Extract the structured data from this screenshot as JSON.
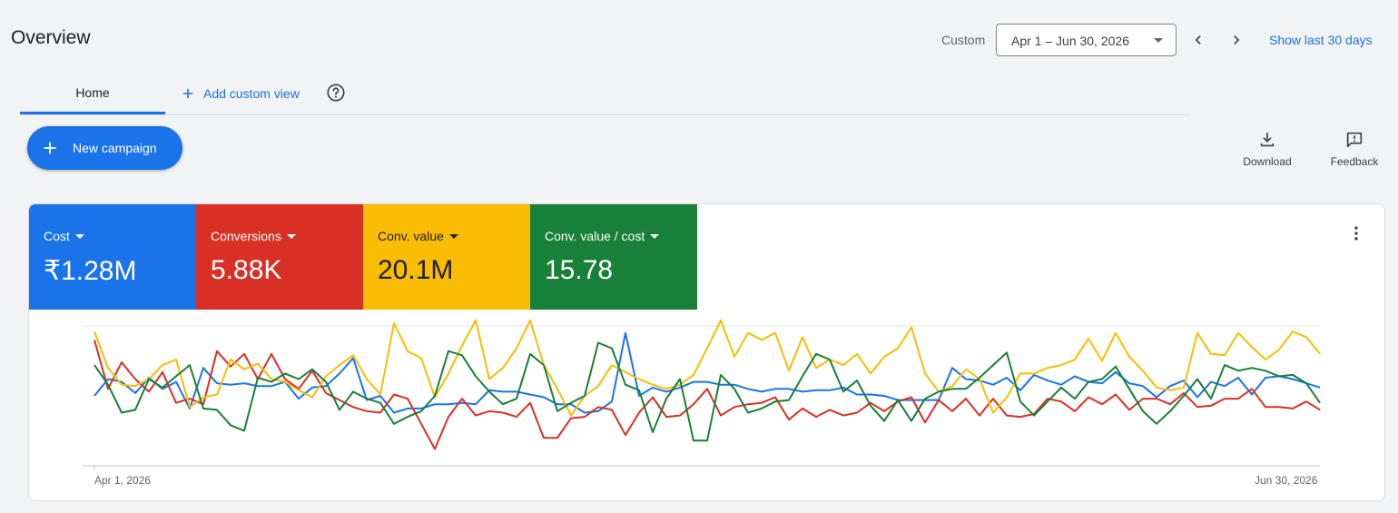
{
  "page": {
    "title": "Overview"
  },
  "date_range": {
    "label": "Custom",
    "value": "Apr 1 – Jun 30, 2026",
    "show_last_label": "Show last 30 days"
  },
  "tabs": {
    "home": "Home",
    "add_custom_view": "Add custom view"
  },
  "actions": {
    "new_campaign": "New campaign",
    "download": "Download",
    "feedback": "Feedback"
  },
  "metrics": [
    {
      "name": "Cost",
      "value": "₹1.28M",
      "color": "#1a73e8"
    },
    {
      "name": "Conversions",
      "value": "5.88K",
      "color": "#d93025"
    },
    {
      "name": "Conv. value",
      "value": "20.1M",
      "color": "#fbbc04"
    },
    {
      "name": "Conv. value / cost",
      "value": "15.78",
      "color": "#188038"
    }
  ],
  "icons": [
    "chevron-left-icon",
    "chevron-right-icon",
    "plus-icon",
    "help-icon",
    "download-icon",
    "feedback-icon",
    "more-vert-icon"
  ],
  "chart_data": {
    "type": "line",
    "x_start_label": "Apr 1, 2026",
    "x_end_label": "Jun 30, 2026",
    "x": [
      "Apr 1",
      "Apr 2",
      "Apr 3",
      "Apr 4",
      "Apr 5",
      "Apr 6",
      "Apr 7",
      "Apr 8",
      "Apr 9",
      "Apr 10",
      "Apr 11",
      "Apr 12",
      "Apr 13",
      "Apr 14",
      "Apr 15",
      "Apr 16",
      "Apr 17",
      "Apr 18",
      "Apr 19",
      "Apr 20",
      "Apr 21",
      "Apr 22",
      "Apr 23",
      "Apr 24",
      "Apr 25",
      "Apr 26",
      "Apr 27",
      "Apr 28",
      "Apr 29",
      "Apr 30",
      "May 1",
      "May 2",
      "May 3",
      "May 4",
      "May 5",
      "May 6",
      "May 7",
      "May 8",
      "May 9",
      "May 10",
      "May 11",
      "May 12",
      "May 13",
      "May 14",
      "May 15",
      "May 16",
      "May 17",
      "May 18",
      "May 19",
      "May 20",
      "May 21",
      "May 22",
      "May 23",
      "May 24",
      "May 25",
      "May 26",
      "May 27",
      "May 28",
      "May 29",
      "May 30",
      "May 31",
      "Jun 1",
      "Jun 2",
      "Jun 3",
      "Jun 4",
      "Jun 5",
      "Jun 6",
      "Jun 7",
      "Jun 8",
      "Jun 9",
      "Jun 10",
      "Jun 11",
      "Jun 12",
      "Jun 13",
      "Jun 14",
      "Jun 15",
      "Jun 16",
      "Jun 17",
      "Jun 18",
      "Jun 19",
      "Jun 20",
      "Jun 21",
      "Jun 22",
      "Jun 23",
      "Jun 24",
      "Jun 25",
      "Jun 26",
      "Jun 27",
      "Jun 28",
      "Jun 29",
      "Jun 30"
    ],
    "ylim": [
      0,
      100
    ],
    "grid": true,
    "series": [
      {
        "name": "Cost",
        "color": "#1a73e8",
        "values": [
          50,
          62,
          60,
          52,
          63,
          55,
          60,
          41,
          70,
          59,
          58,
          59,
          57,
          57,
          60,
          48,
          56,
          57,
          66,
          77,
          47,
          50,
          38,
          41,
          41,
          44,
          44,
          45,
          44,
          54,
          53,
          53,
          51,
          49,
          44,
          44,
          38,
          39,
          46,
          95,
          50,
          56,
          53,
          56,
          60,
          60,
          58,
          58,
          55,
          53,
          55,
          55,
          53,
          54,
          54,
          56,
          51,
          51,
          50,
          47,
          47,
          47,
          47,
          70,
          62,
          61,
          58,
          63,
          54,
          65,
          61,
          58,
          64,
          60,
          59,
          67,
          59,
          57,
          49,
          57,
          61,
          49,
          60,
          57,
          63,
          51,
          63,
          64,
          62,
          59,
          56
        ]
      },
      {
        "name": "Conversions",
        "color": "#d93025",
        "values": [
          90,
          55,
          74,
          62,
          53,
          67,
          45,
          48,
          44,
          82,
          71,
          80,
          62,
          80,
          62,
          55,
          68,
          52,
          47,
          42,
          39,
          38,
          51,
          48,
          30,
          12,
          35,
          48,
          36,
          39,
          38,
          35,
          45,
          20,
          20,
          34,
          35,
          42,
          40,
          22,
          38,
          49,
          35,
          36,
          44,
          55,
          36,
          42,
          44,
          45,
          49,
          33,
          41,
          35,
          40,
          36,
          38,
          45,
          39,
          46,
          49,
          31,
          47,
          39,
          48,
          36,
          48,
          36,
          35,
          37,
          48,
          46,
          39,
          49,
          44,
          51,
          40,
          48,
          48,
          44,
          52,
          42,
          43,
          48,
          48,
          55,
          42,
          42,
          41,
          46,
          40
        ]
      },
      {
        "name": "Conv. value",
        "color": "#fbbc04",
        "values": [
          96,
          70,
          58,
          57,
          62,
          72,
          76,
          42,
          49,
          51,
          76,
          69,
          73,
          62,
          60,
          54,
          49,
          64,
          72,
          79,
          62,
          51,
          102,
          82,
          77,
          49,
          66,
          86,
          104,
          62,
          70,
          84,
          104,
          72,
          55,
          36,
          50,
          57,
          72,
          67,
          62,
          58,
          55,
          58,
          65,
          84,
          104,
          78,
          95,
          90,
          95,
          68,
          92,
          70,
          76,
          72,
          80,
          66,
          78,
          84,
          99,
          66,
          53,
          57,
          69,
          62,
          38,
          49,
          66,
          66,
          70,
          72,
          76,
          91,
          75,
          95,
          78,
          68,
          56,
          54,
          56,
          95,
          80,
          79,
          95,
          85,
          76,
          83,
          96,
          92,
          80
        ]
      },
      {
        "name": "Conv. value / cost",
        "color": "#188038",
        "values": [
          72,
          58,
          38,
          40,
          62,
          56,
          64,
          72,
          41,
          40,
          29,
          25,
          63,
          60,
          66,
          62,
          69,
          60,
          40,
          53,
          48,
          45,
          30,
          35,
          39,
          50,
          82,
          79,
          64,
          53,
          44,
          48,
          80,
          72,
          39,
          45,
          50,
          88,
          84,
          58,
          54,
          24,
          48,
          62,
          18,
          18,
          65,
          55,
          38,
          41,
          46,
          47,
          64,
          80,
          76,
          53,
          61,
          43,
          32,
          47,
          32,
          48,
          53,
          55,
          55,
          63,
          72,
          81,
          46,
          36,
          46,
          56,
          48,
          60,
          62,
          71,
          55,
          39,
          30,
          39,
          50,
          62,
          48,
          72,
          68,
          70,
          68,
          64,
          65,
          59,
          45
        ]
      }
    ]
  }
}
